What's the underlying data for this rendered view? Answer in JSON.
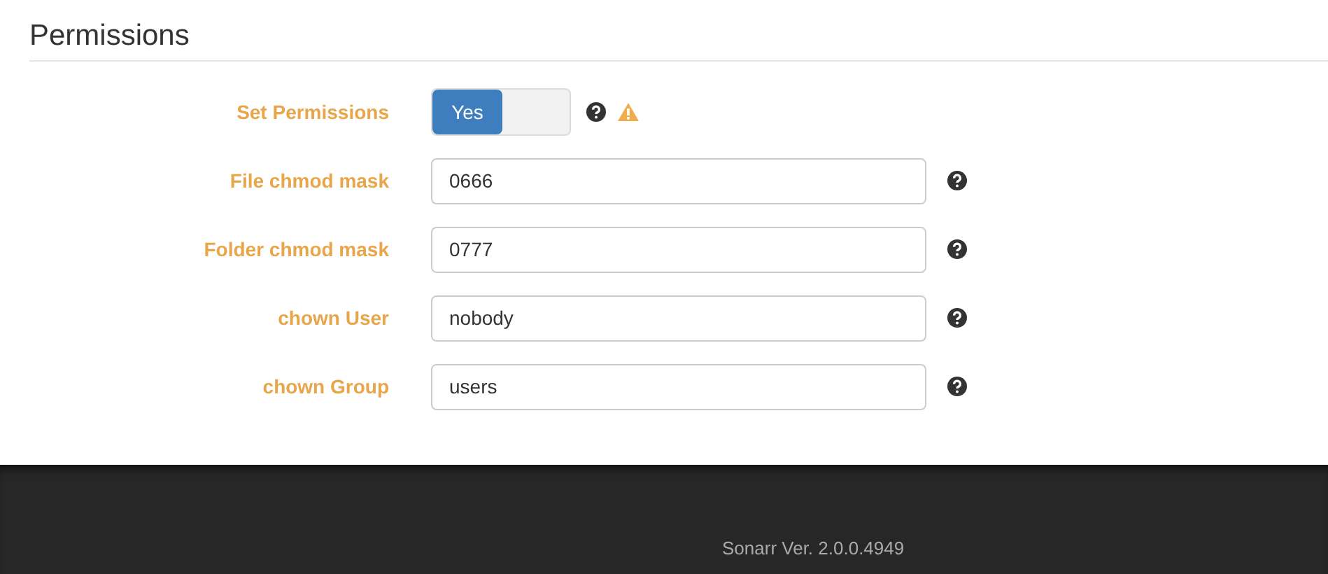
{
  "section": {
    "title": "Permissions"
  },
  "fields": [
    {
      "kind": "toggle",
      "label": "Set Permissions",
      "on_label": "Yes",
      "on": true,
      "warning": true
    },
    {
      "kind": "text",
      "label": "File chmod mask",
      "value": "0666"
    },
    {
      "kind": "text",
      "label": "Folder chmod mask",
      "value": "0777"
    },
    {
      "kind": "text",
      "label": "chown User",
      "value": "nobody"
    },
    {
      "kind": "text",
      "label": "chown Group",
      "value": "users"
    }
  ],
  "footer": {
    "version": "Sonarr Ver. 2.0.0.4949"
  }
}
